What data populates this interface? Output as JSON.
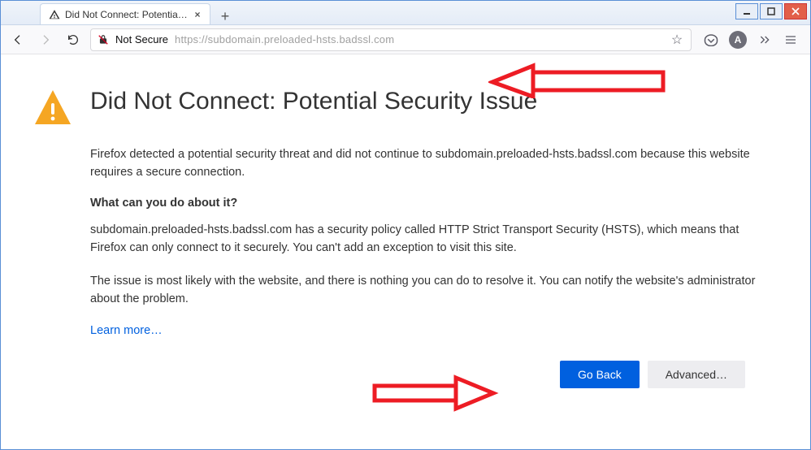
{
  "window": {
    "tab_title": "Did Not Connect: Potential Secu",
    "controls": {
      "min": "—",
      "max": "▢",
      "close": "✕"
    }
  },
  "toolbar": {
    "not_secure": "Not Secure",
    "url": "https://subdomain.preloaded-hsts.badssl.com",
    "avatar_letter": "A"
  },
  "page": {
    "title": "Did Not Connect: Potential Security Issue",
    "lead": "Firefox detected a potential security threat and did not continue to subdomain.preloaded-hsts.badssl.com because this website requires a secure connection.",
    "subhead": "What can you do about it?",
    "body1": "subdomain.preloaded-hsts.badssl.com has a security policy called HTTP Strict Transport Security (HSTS), which means that Firefox can only connect to it securely. You can't add an exception to visit this site.",
    "body2": "The issue is most likely with the website, and there is nothing you can do to resolve it. You can notify the website's administrator about the problem.",
    "learn_more": "Learn more…",
    "go_back": "Go Back",
    "advanced": "Advanced…"
  },
  "annotation": {
    "color": "#ed1c24"
  }
}
